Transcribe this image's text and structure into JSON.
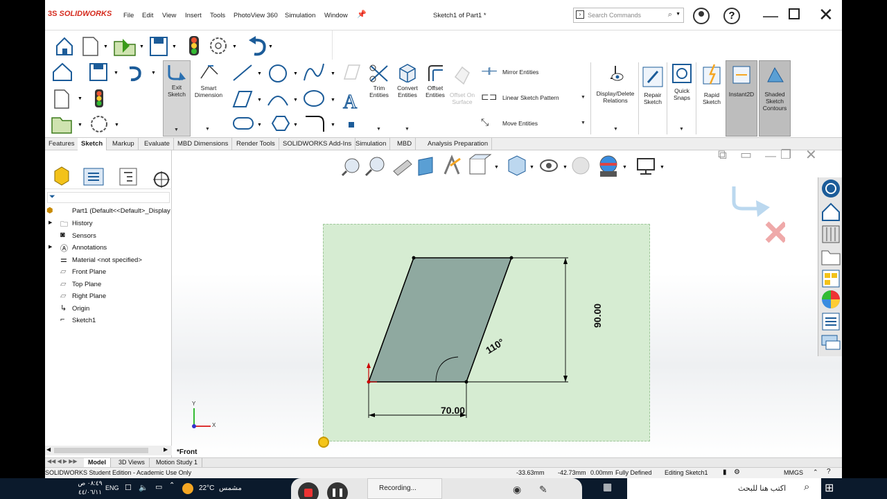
{
  "app": {
    "brand": "SOLIDWORKS",
    "menu": [
      "File",
      "Edit",
      "View",
      "Insert",
      "Tools",
      "PhotoView 360",
      "Simulation",
      "Window"
    ],
    "doc_title": "Sketch1 of Part1 *",
    "search_placeholder": "Search Commands"
  },
  "command_manager": {
    "exit_sketch": "Exit Sketch",
    "smart_dimension": "Smart Dimension",
    "trim": "Trim Entities",
    "convert": "Convert Entities",
    "offset": "Offset Entities",
    "offset_surface": "Offset On Surface",
    "mirror": "Mirror Entities",
    "linear_pattern": "Linear Sketch Pattern",
    "move": "Move Entities",
    "display_delete": "Display/Delete Relations",
    "repair": "Repair Sketch",
    "quick_snaps": "Quick Snaps",
    "rapid": "Rapid Sketch",
    "instant2d": "Instant2D",
    "shaded": "Shaded Sketch Contours"
  },
  "tabs": [
    "Features",
    "Sketch",
    "Markup",
    "Evaluate",
    "MBD Dimensions",
    "Render Tools",
    "SOLIDWORKS Add-Ins",
    "Simulation",
    "MBD",
    "Analysis Preparation"
  ],
  "active_tab": "Sketch",
  "tree": {
    "root": "Part1  (Default<<Default>_Display",
    "items": [
      "History",
      "Sensors",
      "Annotations",
      "Material <not specified>",
      "Front Plane",
      "Top Plane",
      "Right Plane",
      "Origin",
      "Sketch1"
    ]
  },
  "sketch": {
    "dim_width": "70.00",
    "dim_height": "90.00",
    "dim_angle": "110°",
    "view_label": "*Front",
    "axis_x": "X",
    "axis_y": "Y"
  },
  "bottom_tabs": [
    "Model",
    "3D Views",
    "Motion Study 1"
  ],
  "status": {
    "edition": "SOLIDWORKS Student Edition - Academic Use Only",
    "x": "-33.63mm",
    "y": "-42.73mm",
    "z": "0.00mm",
    "state": "Fully Defined",
    "editing": "Editing Sketch1",
    "units": "MMGS"
  },
  "taskbar": {
    "time": "٠٨:٤٩ ص",
    "date": "٤٤/٠٦/١١",
    "lang": "ENG",
    "temp": "22°C",
    "weather": "مشمس",
    "recording": "Recording...",
    "search_placeholder": "اكتب هنا للبحث"
  }
}
